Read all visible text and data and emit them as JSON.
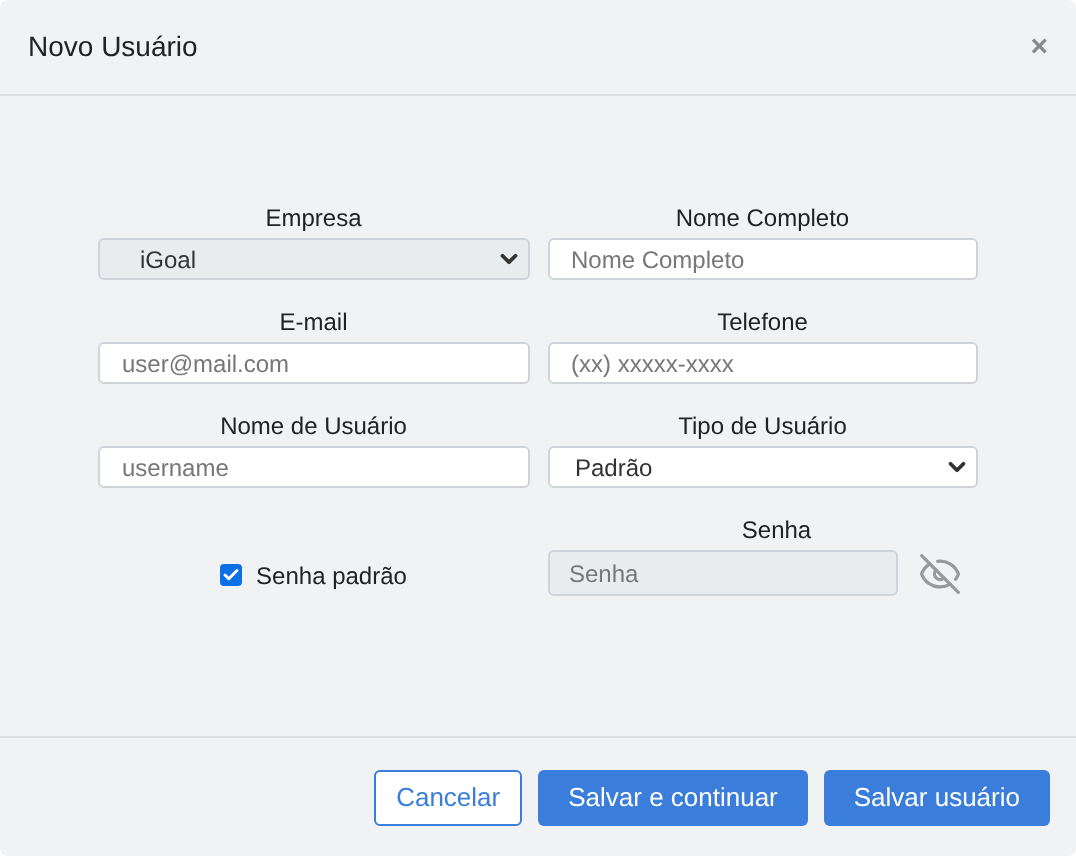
{
  "dialog": {
    "title": "Novo Usuário",
    "close": "×"
  },
  "fields": [
    {
      "label": "Empresa",
      "kind": "select",
      "value": "iGoal",
      "disabled": true
    },
    {
      "label": "Nome Completo",
      "kind": "input",
      "placeholder": "Nome Completo",
      "disabled": false
    },
    {
      "label": "E-mail",
      "kind": "input",
      "placeholder": "user@mail.com",
      "disabled": false
    },
    {
      "label": "Telefone",
      "kind": "input",
      "placeholder": "(xx) xxxxx-xxxx",
      "disabled": false
    },
    {
      "label": "Nome de Usuário",
      "kind": "input",
      "placeholder": "username",
      "disabled": false
    },
    {
      "label": "Tipo de Usuário",
      "kind": "select",
      "value": "Padrão",
      "disabled": false
    }
  ],
  "default_password": {
    "label": "Senha padrão",
    "checked": true
  },
  "password": {
    "label": "Senha",
    "placeholder": "Senha",
    "disabled": true
  },
  "buttons": [
    {
      "label": "Cancelar",
      "kind": "outline"
    },
    {
      "label": "Salvar e continuar",
      "kind": "primary"
    },
    {
      "label": "Salvar usuário",
      "kind": "primary"
    }
  ]
}
